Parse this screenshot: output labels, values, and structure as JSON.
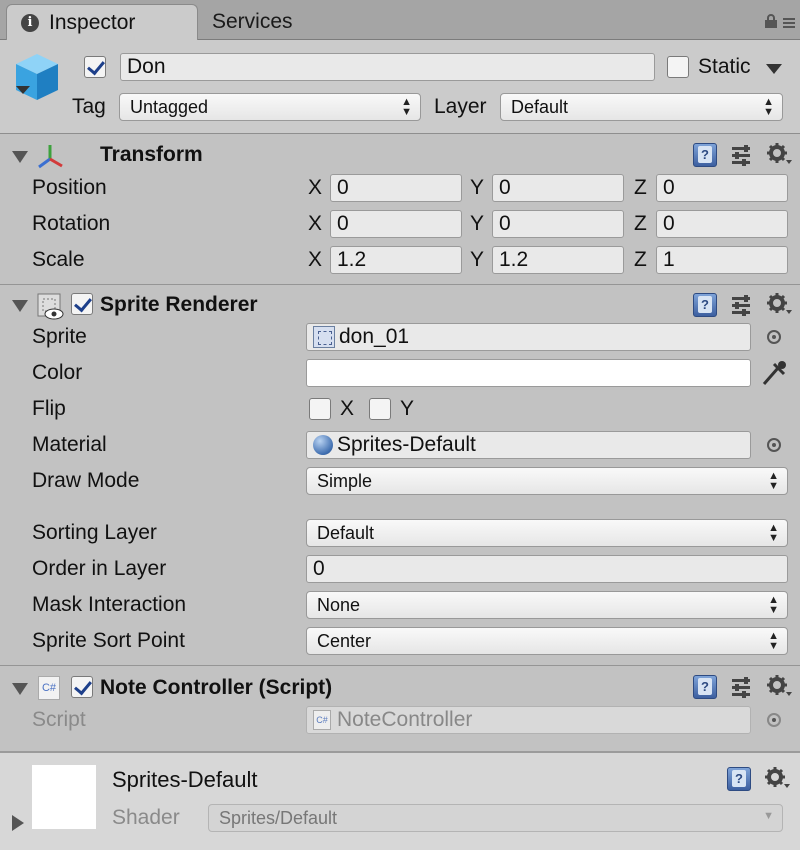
{
  "tabs": [
    {
      "label": "Inspector",
      "active": true
    },
    {
      "label": "Services",
      "active": false
    }
  ],
  "header": {
    "object_name": "Don",
    "active": true,
    "static_label": "Static",
    "static": false,
    "tag_label": "Tag",
    "tag_value": "Untagged",
    "layer_label": "Layer",
    "layer_value": "Default"
  },
  "transform": {
    "title": "Transform",
    "position_label": "Position",
    "rotation_label": "Rotation",
    "scale_label": "Scale",
    "axis_x": "X",
    "axis_y": "Y",
    "axis_z": "Z",
    "position": {
      "x": "0",
      "y": "0",
      "z": "0"
    },
    "rotation": {
      "x": "0",
      "y": "0",
      "z": "0"
    },
    "scale": {
      "x": "1.2",
      "y": "1.2",
      "z": "1"
    }
  },
  "sprite_renderer": {
    "title": "Sprite Renderer",
    "enabled": true,
    "sprite_label": "Sprite",
    "sprite_value": "don_01",
    "color_label": "Color",
    "color_value": "#ffffff",
    "flip_label": "Flip",
    "flip_x_label": "X",
    "flip_y_label": "Y",
    "material_label": "Material",
    "material_value": "Sprites-Default",
    "draw_mode_label": "Draw Mode",
    "draw_mode_value": "Simple",
    "sorting_layer_label": "Sorting Layer",
    "sorting_layer_value": "Default",
    "order_label": "Order in Layer",
    "order_value": "0",
    "mask_label": "Mask Interaction",
    "mask_value": "None",
    "sort_point_label": "Sprite Sort Point",
    "sort_point_value": "Center"
  },
  "note_controller": {
    "title": "Note Controller (Script)",
    "enabled": true,
    "icon_text": "C#",
    "script_label": "Script",
    "script_value": "NoteController"
  },
  "material": {
    "name": "Sprites-Default",
    "shader_label": "Shader",
    "shader_value": "Sprites/Default"
  }
}
